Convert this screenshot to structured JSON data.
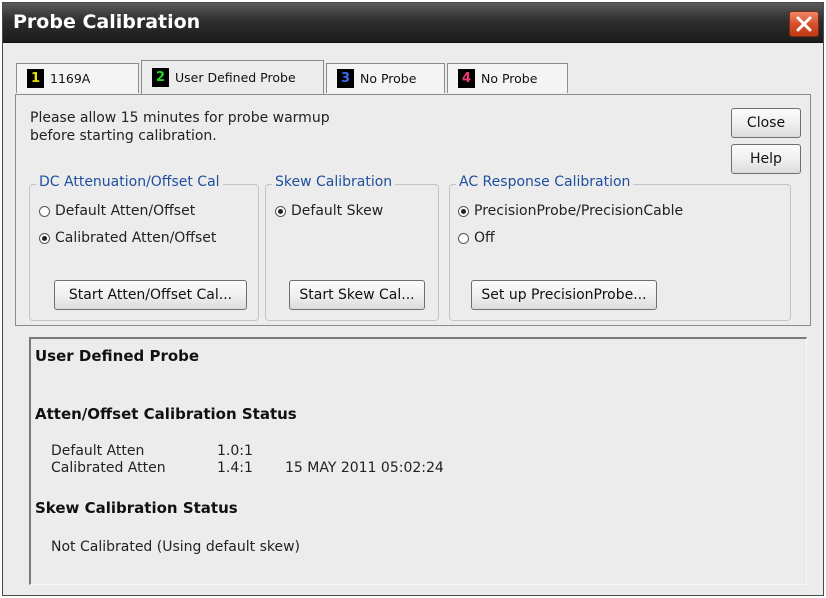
{
  "window": {
    "title": "Probe Calibration"
  },
  "tabs": [
    {
      "number": "1",
      "label": "1169A",
      "num_color": "#e8e000",
      "active": false
    },
    {
      "number": "2",
      "label": "User Defined Probe",
      "num_color": "#28d428",
      "active": true
    },
    {
      "number": "3",
      "label": "No Probe",
      "num_color": "#3a6cf0",
      "active": false
    },
    {
      "number": "4",
      "label": "No Probe",
      "num_color": "#f03a78",
      "active": false
    }
  ],
  "warmup_text": "Please allow 15 minutes for probe warmup before starting calibration.",
  "buttons": {
    "close": "Close",
    "help": "Help"
  },
  "groups": {
    "dc": {
      "label": "DC Attenuation/Offset Cal",
      "options": [
        "Default Atten/Offset",
        "Calibrated Atten/Offset"
      ],
      "selected": 1,
      "button": "Start Atten/Offset Cal..."
    },
    "skew": {
      "label": "Skew Calibration",
      "options": [
        "Default Skew"
      ],
      "selected": 0,
      "button": "Start Skew Cal..."
    },
    "ac": {
      "label": "AC Response Calibration",
      "options": [
        "PrecisionProbe/PrecisionCable",
        "Off"
      ],
      "selected": 0,
      "button": "Set up PrecisionProbe..."
    }
  },
  "status": {
    "heading": "User Defined Probe",
    "atten_title": "Atten/Offset Calibration Status",
    "atten_rows": [
      {
        "label": "Default Atten",
        "value": "1.0:1",
        "date": ""
      },
      {
        "label": "Calibrated Atten",
        "value": "1.4:1",
        "date": "15 MAY 2011 05:02:24"
      }
    ],
    "skew_title": "Skew Calibration Status",
    "skew_text": "Not Calibrated (Using default skew)"
  },
  "colors": {
    "group_label": "#1f4f9e",
    "close_button": "#d9502c"
  },
  "icons": {
    "close": "close-x-icon",
    "radio": "radio-button-icon"
  }
}
